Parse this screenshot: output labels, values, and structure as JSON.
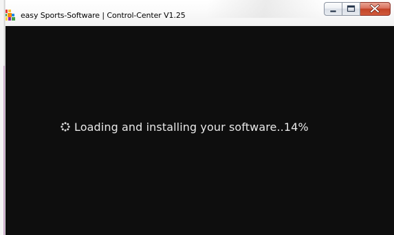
{
  "window": {
    "title": "easy Sports-Software | Control-Center V1.25",
    "icons": {
      "app": "app-icon",
      "minimize": "minimize-icon",
      "maximize": "maximize-icon",
      "close": "close-icon"
    }
  },
  "content": {
    "status_text": "Loading and installing your software..14%",
    "progress_percent": 14,
    "spinner_icon": "spinner-icon",
    "background_color": "#0e0e0e",
    "text_color": "#e8e8e8"
  }
}
